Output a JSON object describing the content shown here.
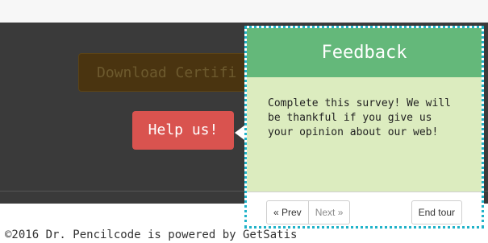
{
  "page": {
    "download_label": "Download Certifi",
    "help_label": "Help us!",
    "footer_text": "©2016 Dr. Pencilcode is powered by GetSatis"
  },
  "tour": {
    "title": "Feedback",
    "content": "Complete this survey! We will be thankful if you give us your opinion about our web!",
    "buttons": {
      "prev": "« Prev",
      "next": "Next »",
      "end": "End tour"
    }
  },
  "colors": {
    "page_dark": "#3a3a3a",
    "help_button": "#d9534f",
    "popover_header": "#64b87a",
    "popover_body": "#dcecbf",
    "popover_outline": "#21b3c9"
  }
}
